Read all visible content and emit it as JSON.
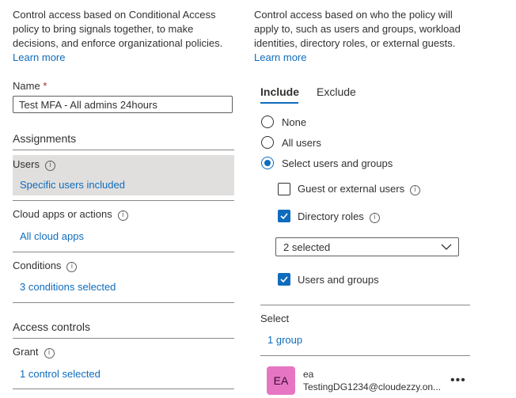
{
  "left": {
    "description": "Control access based on Conditional Access policy to bring signals together, to make decisions, and enforce organizational policies.",
    "learn_more": "Learn more",
    "name_label": "Name",
    "required_mark": "*",
    "name_value": "Test MFA - All admins 24hours",
    "assignments_heading": "Assignments",
    "users_label": "Users",
    "users_value": "Specific users included",
    "cloud_apps_label": "Cloud apps or actions",
    "cloud_apps_value": "All cloud apps",
    "conditions_label": "Conditions",
    "conditions_value": "3 conditions selected",
    "access_controls_heading": "Access controls",
    "grant_label": "Grant",
    "grant_value": "1 control selected"
  },
  "right": {
    "description": "Control access based on who the policy will apply to, such as users and groups, workload identities, directory roles, or external guests.",
    "learn_more": "Learn more",
    "tabs": [
      "Include",
      "Exclude"
    ],
    "radio_options": [
      "None",
      "All users",
      "Select users and groups"
    ],
    "selected_radio": "Select users and groups",
    "guest_label": "Guest or external users",
    "guest_checked": false,
    "directory_roles_label": "Directory roles",
    "directory_roles_checked": true,
    "dropdown_value": "2 selected",
    "users_groups_label": "Users and groups",
    "users_groups_checked": true,
    "select_label": "Select",
    "select_value": "1 group",
    "member": {
      "initials": "EA",
      "name": "ea",
      "email": "TestingDG1234@cloudezzy.on...",
      "avatar_color": "#e676c3"
    }
  },
  "colors": {
    "accent": "#0f6cbd",
    "selected_row_bg": "#e1dfdd"
  }
}
